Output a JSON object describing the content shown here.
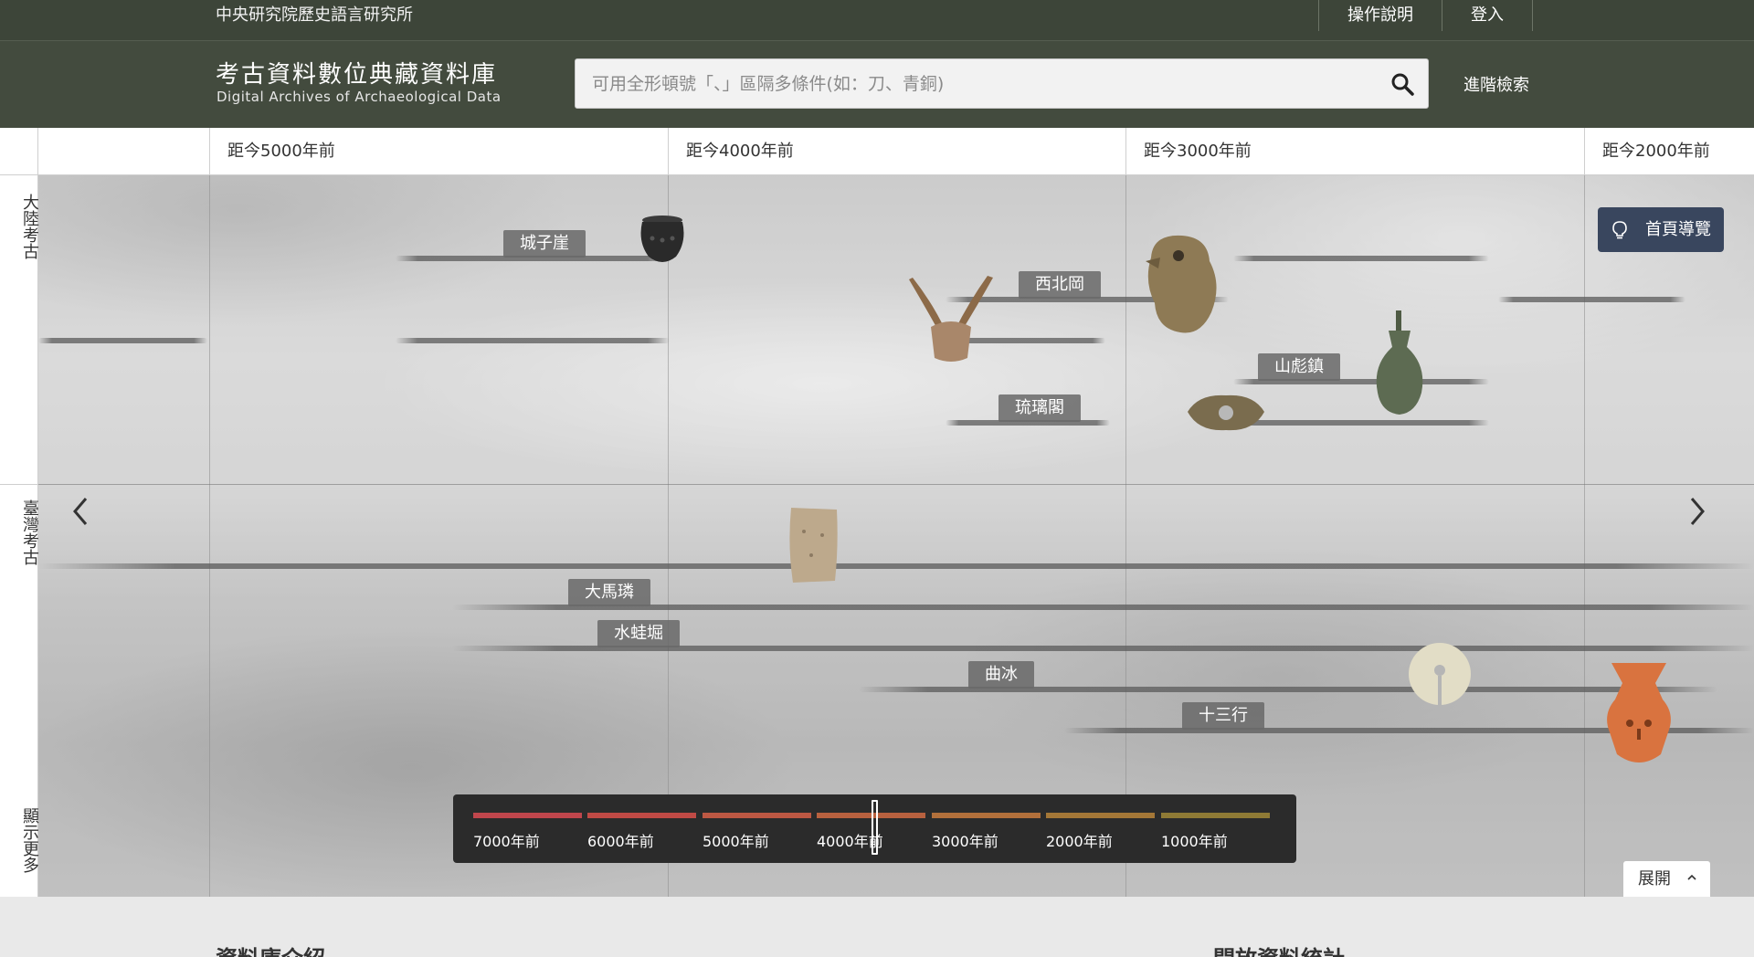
{
  "topbar": {
    "org": "中央研究院歷史語言研究所",
    "links": [
      "操作說明",
      "登入"
    ]
  },
  "header": {
    "title_zh": "考古資料數位典藏資料庫",
    "title_en": "Digital Archives of Archaeological Data",
    "search_placeholder": "可用全形頓號「、」區隔多條件(如：刀、青銅)",
    "advanced_search": "進階檢索"
  },
  "timeline": {
    "ticks": [
      "距今5000年前",
      "距今4000年前",
      "距今3000年前",
      "距今2000年前"
    ],
    "side_labels": [
      "大陸考古",
      "臺灣考古",
      "顯示更多"
    ],
    "sites_mainland": [
      "城子崖",
      "西北岡",
      "山彪鎮",
      "琉璃閣"
    ],
    "sites_taiwan": [
      "大馬璘",
      "水蛙堀",
      "曲冰",
      "十三行"
    ],
    "guide_button": "首頁導覽",
    "expand_button": "展開"
  },
  "minimap": {
    "labels": [
      "7000年前",
      "6000年前",
      "5000年前",
      "4000年前",
      "3000年前",
      "2000年前",
      "1000年前"
    ],
    "colors": [
      "#c0464c",
      "#c04a45",
      "#bd5843",
      "#b8613f",
      "#b2703b",
      "#a47737",
      "#8f7a35"
    ]
  },
  "lower": {
    "intro_heading": "資料庫介紹",
    "stats_heading": "開放資料統計"
  },
  "colors": {
    "header_bg": "#434b3e",
    "topbar_bg": "#3d4539",
    "guide_bg": "#39465e"
  }
}
